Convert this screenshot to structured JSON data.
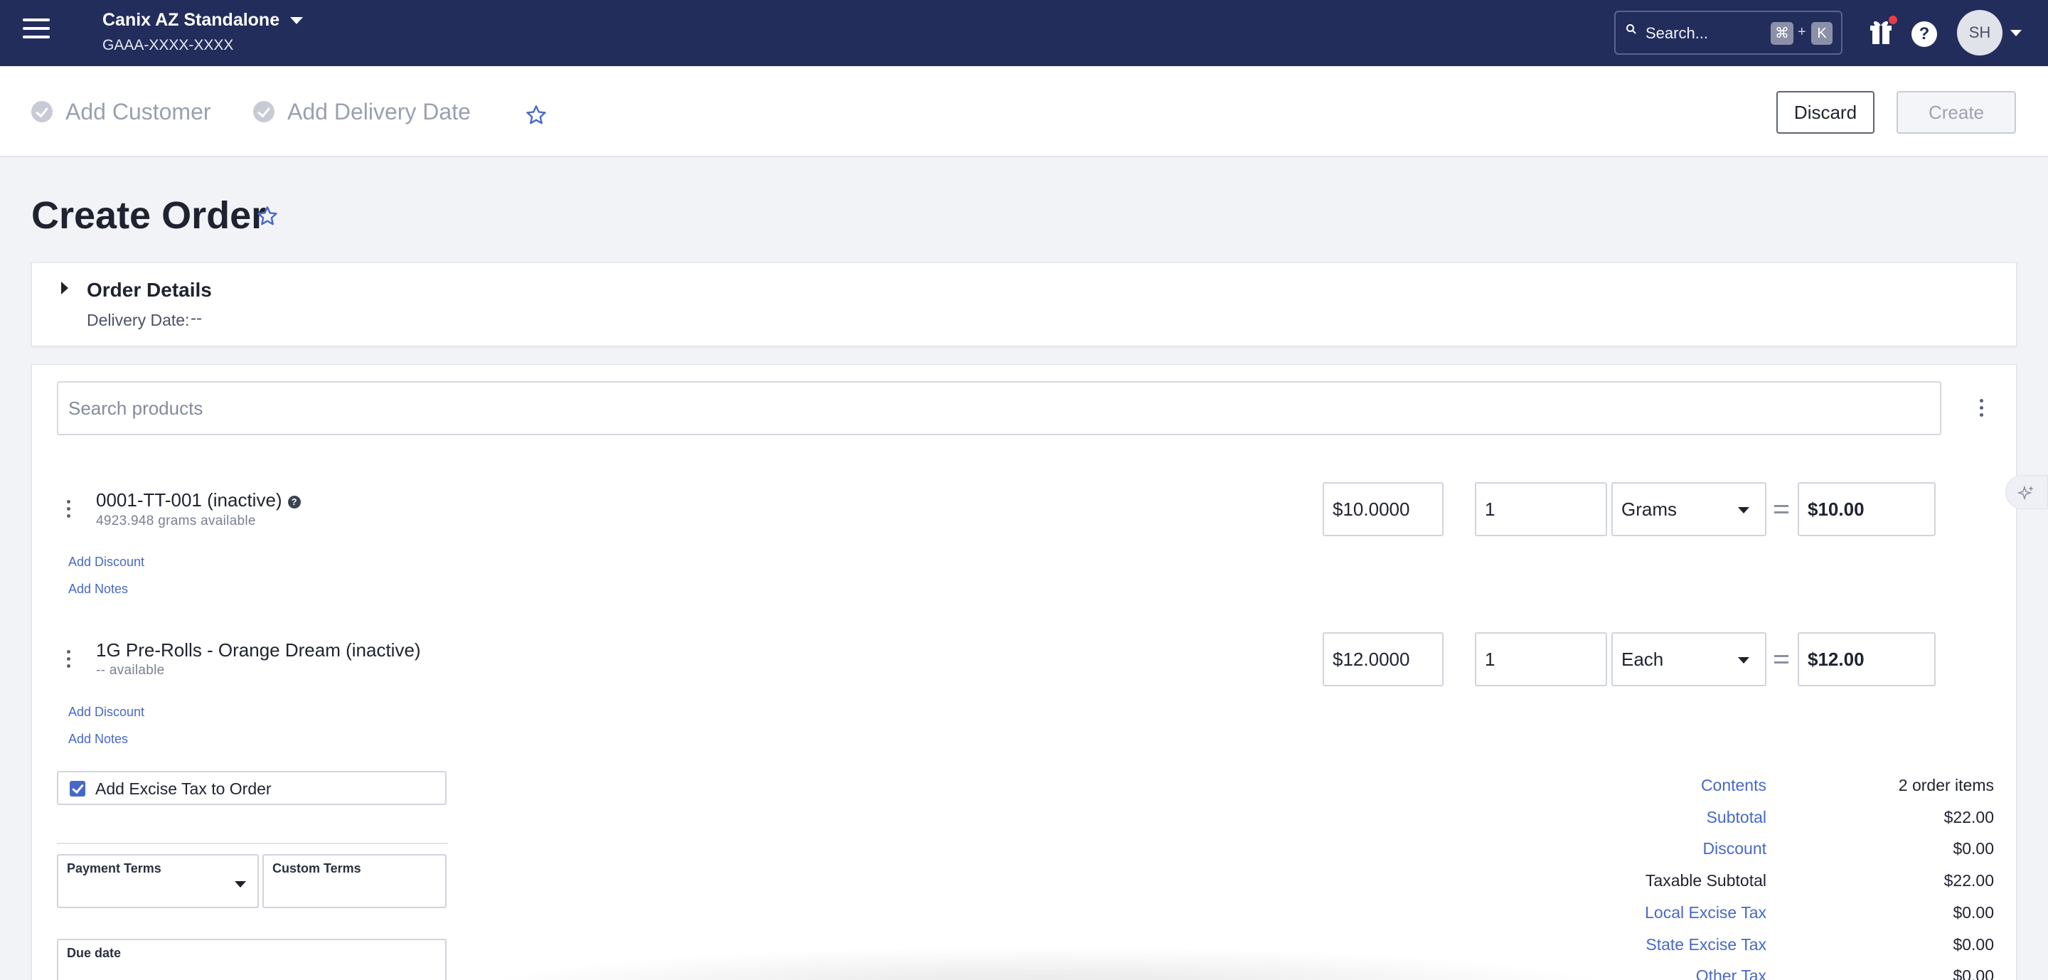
{
  "topbar": {
    "org_name": "Canix AZ Standalone",
    "license": "GAAA-XXXX-XXXX",
    "search_label": "Search...",
    "kbd_cmd": "⌘",
    "kbd_plus": "+",
    "kbd_key": "K",
    "help": "?",
    "avatar_initials": "SH",
    "notification_color": "#e53d4a"
  },
  "steps": {
    "customer": "Add Customer",
    "delivery": "Add Delivery Date"
  },
  "actions": {
    "discard": "Discard",
    "create": "Create"
  },
  "page": {
    "title": "Create Order"
  },
  "order_details": {
    "title": "Order Details",
    "delivery_label": "Delivery Date:",
    "delivery_value": "--"
  },
  "product_search": {
    "placeholder": "Search products"
  },
  "items": [
    {
      "name": "0001-TT-001 (inactive)",
      "availability": "4923.948 grams available",
      "price": "$10.0000",
      "quantity": "1",
      "unit": "Grams",
      "total": "$10.00",
      "add_discount": "Add Discount",
      "add_notes": "Add Notes"
    },
    {
      "name": "1G Pre-Rolls - Orange Dream (inactive)",
      "availability": "-- available",
      "price": "$12.0000",
      "quantity": "1",
      "unit": "Each",
      "total": "$12.00",
      "add_discount": "Add Discount",
      "add_notes": "Add Notes"
    }
  ],
  "form": {
    "excise_tax": "Add Excise Tax to Order",
    "excise_checked": true,
    "payment_terms": "Payment Terms",
    "custom_terms": "Custom Terms",
    "due_date": "Due date"
  },
  "summary": [
    {
      "label": "Contents",
      "value": "2 order items"
    },
    {
      "label": "Subtotal",
      "value": "$22.00"
    },
    {
      "label": "Discount",
      "value": "$0.00"
    },
    {
      "label": "Taxable Subtotal",
      "value": "$22.00"
    },
    {
      "label": "Local Excise Tax",
      "value": "$0.00"
    },
    {
      "label": "State Excise Tax",
      "value": "$0.00"
    },
    {
      "label": "Other Tax",
      "value": "$0.00"
    }
  ],
  "colors": {
    "navbar": "#232d5c",
    "link": "#4868c9"
  }
}
